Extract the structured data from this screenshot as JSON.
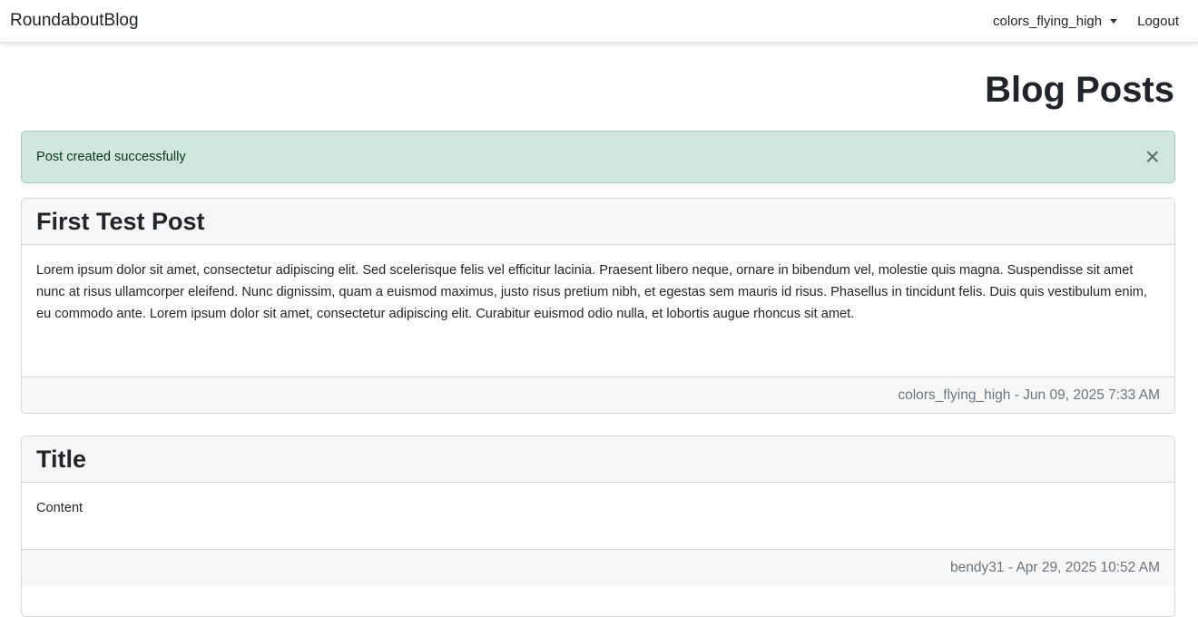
{
  "navbar": {
    "brand": "RoundaboutBlog",
    "user": "colors_flying_high",
    "logout": "Logout"
  },
  "page_title": "Blog Posts",
  "alert": {
    "message": "Post created successfully",
    "close": "×",
    "color": "#d1e7dd"
  },
  "posts": [
    {
      "title": "First Test Post",
      "content": "Lorem ipsum dolor sit amet, consectetur adipiscing elit. Sed scelerisque felis vel efficitur lacinia. Praesent libero neque, ornare in bibendum vel, molestie quis magna. Suspendisse sit amet nunc at risus ullamcorper eleifend. Nunc dignissim, quam a euismod maximus, justo risus pretium nibh, et egestas sem mauris id risus. Phasellus in tincidunt felis. Duis quis vestibulum enim, eu commodo ante. Lorem ipsum dolor sit amet, consectetur adipiscing elit. Curabitur euismod odio nulla, et lobortis augue rhoncus sit amet.",
      "meta": "colors_flying_high - Jun 09, 2025 7:33 AM"
    },
    {
      "title": "Title",
      "content": "Content",
      "meta": "bendy31 - Apr 29, 2025 10:52 AM"
    }
  ]
}
